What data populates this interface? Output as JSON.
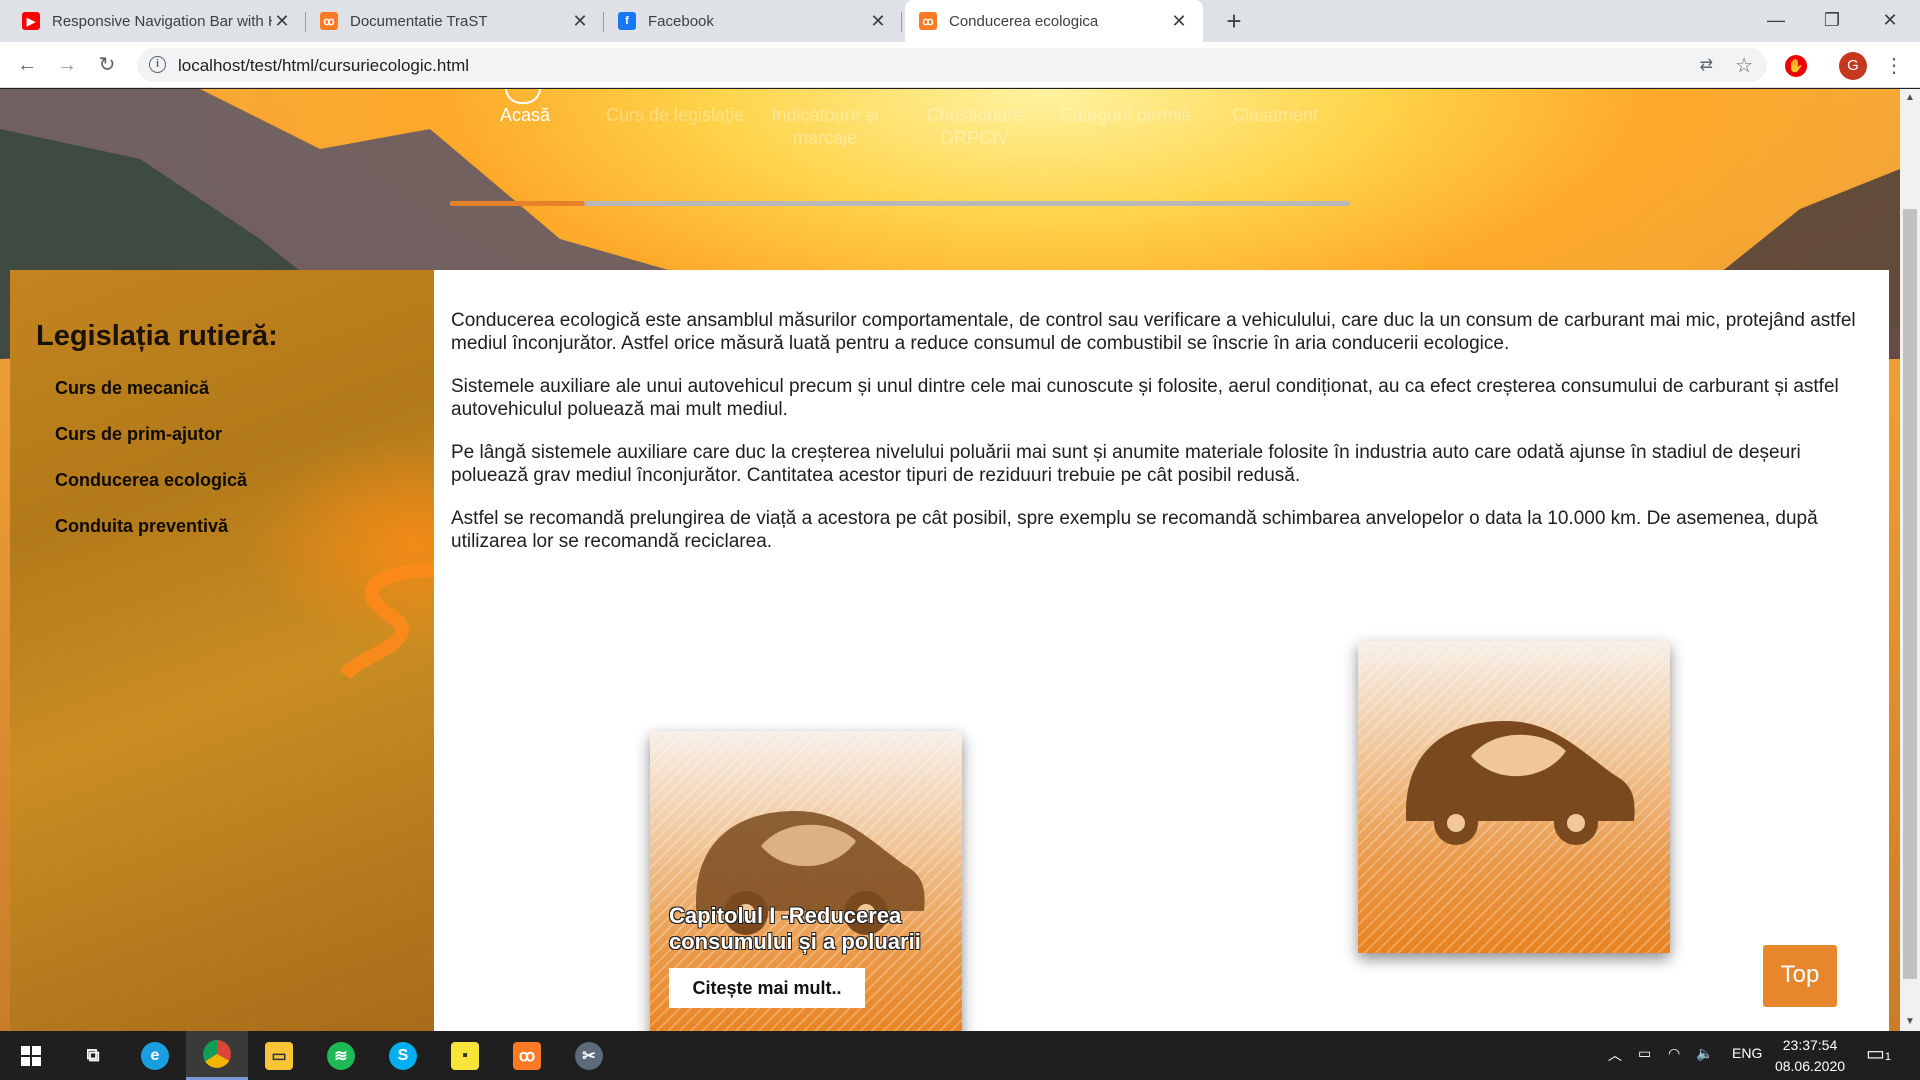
{
  "browser": {
    "tabs": [
      {
        "title": "Responsive Navigation Bar with HTML",
        "favicon": "youtube-icon",
        "color": "#ff0000"
      },
      {
        "title": "Documentatie TraST",
        "favicon": "xampp-icon",
        "color": "#fb7a24"
      },
      {
        "title": "Facebook",
        "favicon": "facebook-icon",
        "color": "#1877f2"
      },
      {
        "title": "Conducerea ecologica",
        "favicon": "xampp-icon",
        "color": "#fb7a24"
      }
    ],
    "new_tab": "+",
    "url": "localhost/test/html/cursuriecologic.html"
  },
  "nav": {
    "items": [
      {
        "label": "Acasă",
        "active": true
      },
      {
        "label": "Curs de legislație",
        "active": false
      },
      {
        "label": "Indicatoare și marcaje",
        "active": false
      },
      {
        "label": "Chestionare DRPCIV",
        "active": false
      },
      {
        "label": "Categorii permis",
        "active": false
      },
      {
        "label": "Clasament",
        "active": false
      }
    ],
    "progress": 0.15
  },
  "sidebar": {
    "title": "Legislația rutieră:",
    "links": [
      "Curs de mecanică",
      "Curs de prim-ajutor",
      "Conducerea ecologică",
      "Conduita preventivă"
    ]
  },
  "content": {
    "paragraphs": [
      "Conducerea ecologică este ansamblul măsurilor comportamentale, de control sau verificare a vehiculului, care duc la un consum de carburant mai mic, protejând astfel mediul înconjurător. Astfel orice măsură luată pentru a reduce consumul de combustibil se înscrie în aria conducerii ecologice.",
      "Sistemele auxiliare ale unui autovehicul precum și unul dintre cele mai cunoscute și folosite, aerul condiționat, au ca efect creșterea consumului de carburant și astfel autovehiculul poluează mai mult mediul.",
      "Pe lângă sistemele auxiliare care duc la creșterea nivelului poluării mai sunt și anumite materiale folosite în industria auto care odată ajunse în stadiul de deșeuri poluează grav mediul înconjurător. Cantitatea acestor tipuri de reziduuri trebuie pe cât posibil redusă.",
      "Astfel se recomandă prelungirea de viață a acestora pe cât posibil, spre exemplu se recomandă schimbarea anvelopelor o data la 10.000 km. De asemenea, după utilizarea lor se recomandă reciclarea."
    ],
    "cards": [
      {
        "title": "Capitolul I -Reducerea consumului și a poluarii",
        "button": "Citește mai mult..",
        "icon": "eco-car-icon"
      },
      {
        "icon": "eco-car-icon"
      }
    ],
    "top_button": "Top"
  },
  "taskbar": {
    "lang": "ENG",
    "time": "23:37:54",
    "date": "08.06.2020",
    "notifications": "1"
  },
  "colors": {
    "accent": "#e8862c",
    "sidebar": "#b77c1c"
  }
}
